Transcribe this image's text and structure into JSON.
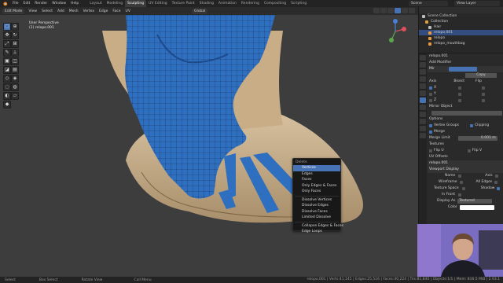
{
  "topbar": {
    "menus": [
      "File",
      "Edit",
      "Render",
      "Window",
      "Help"
    ],
    "workspaces": [
      "Layout",
      "Modeling",
      "Sculpting",
      "UV Editing",
      "Texture Paint",
      "Shading",
      "Animation",
      "Rendering",
      "Compositing",
      "Scripting"
    ],
    "active_workspace": "Sculpting",
    "scene": "Scene",
    "view_layer": "View Layer"
  },
  "header": {
    "mode": "Edit Mode",
    "menus": [
      "View",
      "Select",
      "Add",
      "Mesh",
      "Vertex",
      "Edge",
      "Face",
      "UV"
    ],
    "orientation": "Global"
  },
  "viewport": {
    "view_name": "User Perspective",
    "object_name": "(1) relopo.001"
  },
  "delete_menu": {
    "title": "Delete",
    "items": [
      "Vertices",
      "Edges",
      "Faces",
      "Only Edges & Faces",
      "Only Faces",
      "Dissolve Vertices",
      "Dissolve Edges",
      "Dissolve Faces",
      "Limited Dissolve",
      "Collapse Edges & Faces",
      "Edge Loops"
    ],
    "selected_index": 0,
    "accent": "#4772b3"
  },
  "outliner": {
    "rows": [
      {
        "label": "Scene Collection",
        "color": "#bcbcbc"
      },
      {
        "label": "Collection",
        "color": "#e0a040"
      },
      {
        "label": "Hair",
        "color": "#bcbcbc"
      },
      {
        "label": "relopo.001",
        "color": "#e89a3a"
      },
      {
        "label": "relopo",
        "color": "#e89a3a"
      },
      {
        "label": "relopo_mouthbag",
        "color": "#e89a3a"
      }
    ]
  },
  "properties": {
    "object": "relopo.001",
    "section_add_modifier": "Add Modifier",
    "modifier_name": "Mir",
    "apply": "Copy",
    "axis_label": "Axis",
    "bisect_label": "Bisect",
    "flip_label": "Flip",
    "axes": [
      "X",
      "Y",
      "Z"
    ],
    "mirror_object": "Mirror Object",
    "options": "Options",
    "vertex_groups": "Vertex Groups",
    "clipping": "Clipping",
    "merge": "Merge",
    "merge_limit_label": "Merge Limit",
    "merge_limit": "0.001 m",
    "textures": "Textures",
    "flip_u": "Flip U",
    "flip_v": "Flip V",
    "uv_offsets": "UV Offsets",
    "object_name_row": "relopo.001",
    "viewport_display": "Viewport Display",
    "name": "Name",
    "axis": "Axis",
    "wireframe": "Wireframe",
    "all_edges": "All Edges",
    "texture_space": "Texture Space",
    "shadow": "Shadow",
    "in_front": "In Front",
    "display_as_label": "Display As",
    "display_as": "Textured",
    "color_label": "Color"
  },
  "statusbar": {
    "left": [
      "Select",
      "Box Select",
      "Rotate View",
      "Call Menu"
    ],
    "right": "relopo.001 | Verts:41,145 | Edges:25,516 | Faces:40,224 | Tris:81,840 | Objects:1/1 | Mem: 816.5 MiB | 2.93.1"
  },
  "colors": {
    "mesh_blue": "#2f6fc0",
    "skin": "#c9b08a",
    "viewport_bg": "#3d3d3d"
  }
}
